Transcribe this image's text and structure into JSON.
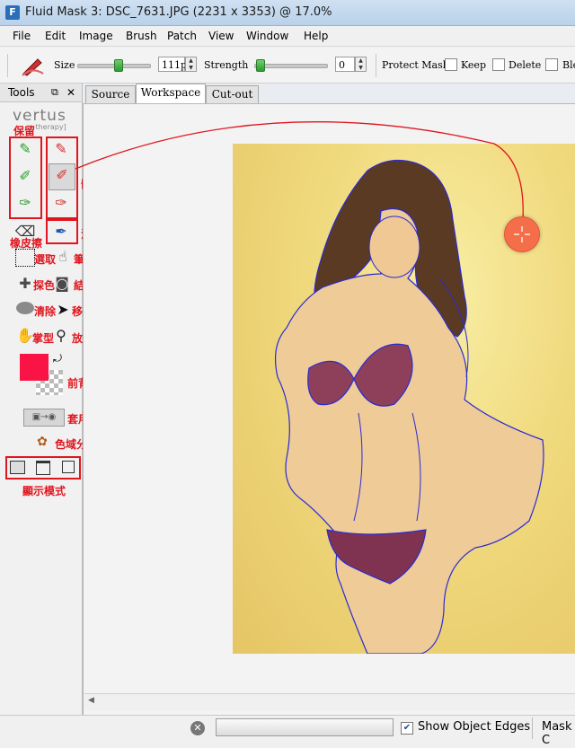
{
  "window": {
    "title": "Fluid Mask 3: DSC_7631.JPG (2231 x 3353) @ 17.0%",
    "app_icon": "fluid-mask-app-icon"
  },
  "menu": {
    "items": [
      "File",
      "Edit",
      "Image",
      "Brush",
      "Patch",
      "View",
      "Window",
      "Help"
    ]
  },
  "toolbar": {
    "size_label": "Size",
    "size_value": "111px",
    "strength_label": "Strength",
    "strength_value": "0",
    "protect_mask_label": "Protect Mask:",
    "keep_label": "Keep",
    "delete_label": "Delete",
    "blend_label": "Ble",
    "size_slider_level": 0.55,
    "strength_slider_level": 0.02
  },
  "tools_panel": {
    "title": "Tools",
    "brand": "vertus",
    "brand_sub": "e therapy]",
    "annotations": {
      "keep": "保留",
      "delete": "刪除",
      "eraser": "橡皮擦",
      "blend": "混合",
      "select": "選取",
      "brush_type": "筆型",
      "pick_color": "探色",
      "result_preview": "結果預覽",
      "clear": "清除",
      "move": "移動",
      "hand": "掌型",
      "zoom": "放大鏡",
      "fg_bg_color": "前背景色",
      "apply": "套用",
      "color_distribution": "色域分佈圖",
      "display_mode": "顯示模式"
    },
    "foreground_color": "#fa1446"
  },
  "tabs": [
    {
      "label": "Source",
      "active": false
    },
    {
      "label": "Workspace",
      "active": true
    },
    {
      "label": "Cut-out",
      "active": false
    }
  ],
  "status": {
    "show_edges_label": "Show Object Edges",
    "show_edges_checked": true,
    "mask_label": "Mask C"
  },
  "colors": {
    "annotation_red": "#e0161f",
    "edge_blue": "#2b2bd6",
    "cursor_orange": "#f46e4a"
  }
}
